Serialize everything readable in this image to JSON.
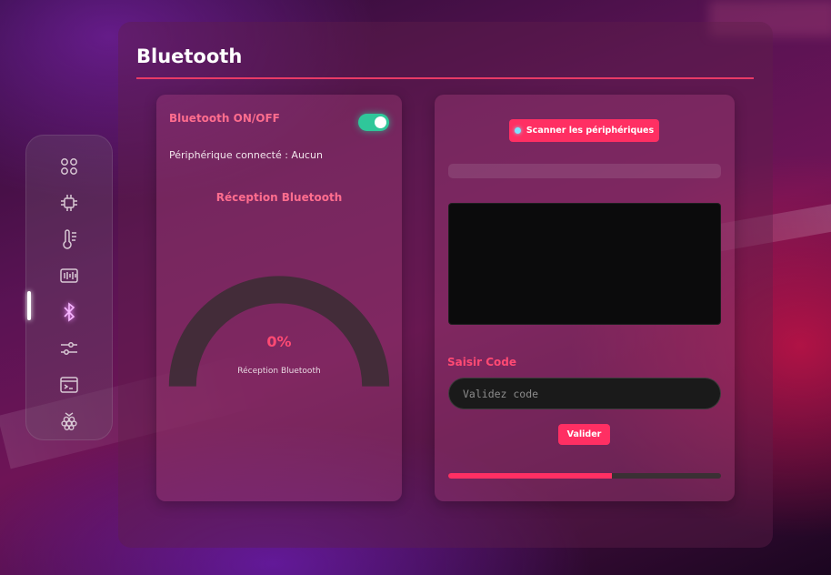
{
  "page": {
    "title": "Bluetooth"
  },
  "sidebar": {
    "items": [
      {
        "icon": "grid-icon",
        "active": false
      },
      {
        "icon": "chip-icon",
        "active": false
      },
      {
        "icon": "thermometer-icon",
        "active": false
      },
      {
        "icon": "equalizer-icon",
        "active": false
      },
      {
        "icon": "bluetooth-icon",
        "active": true
      },
      {
        "icon": "sliders-icon",
        "active": false
      },
      {
        "icon": "terminal-icon",
        "active": false
      },
      {
        "icon": "raspberry-icon",
        "active": false
      }
    ]
  },
  "bluetooth_card": {
    "toggle_label": "Bluetooth ON/OFF",
    "toggle_on": true,
    "connected_device": "Périphérique connecté : Aucun",
    "reception_heading": "Réception Bluetooth",
    "gauge_value": "0%",
    "gauge_percent": 0,
    "gauge_caption": "Réception Bluetooth"
  },
  "scan_card": {
    "scan_button_label": "Scanner les périphériques",
    "code_label": "Saisir Code",
    "code_input": {
      "value": "",
      "placeholder": "Validez code"
    },
    "validate_button_label": "Valider",
    "code_progress_percent": 60
  },
  "colors": {
    "accent": "#ff2f63",
    "accent_text": "#ff6d8e",
    "toggle_on": "#2fc79a",
    "gauge_track": "#3e2d36",
    "sidebar_icon": "#d8c8d4",
    "sidebar_icon_active": "#f7b6ff"
  }
}
